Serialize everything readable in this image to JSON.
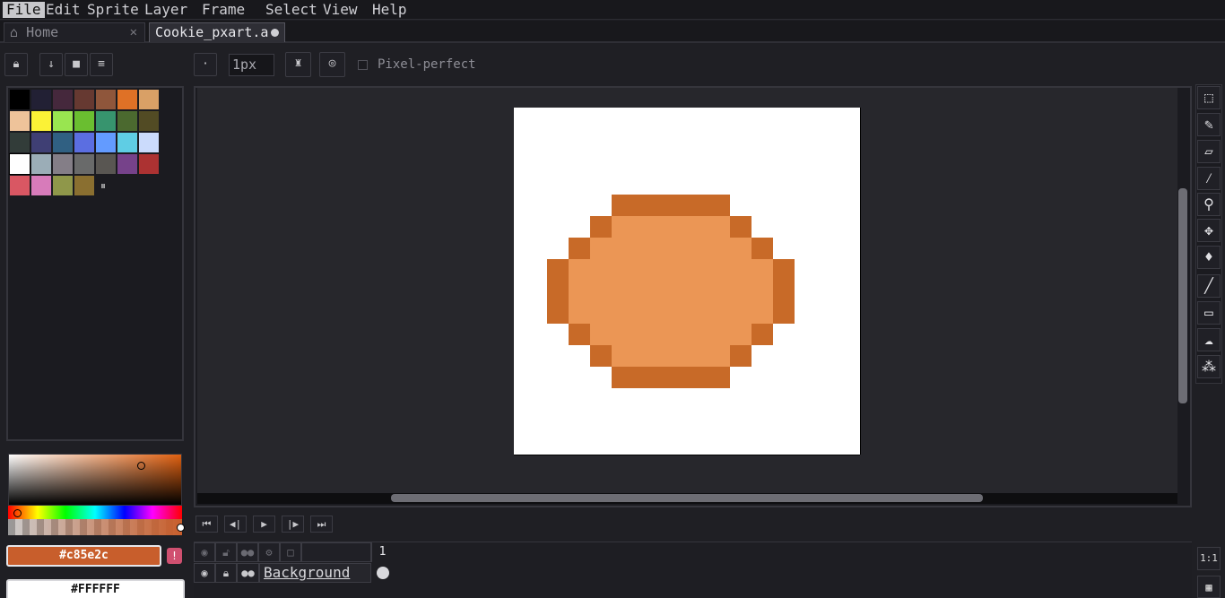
{
  "menu": [
    "File",
    "Edit",
    "Sprite",
    "Layer",
    "Frame",
    "Select",
    "View",
    "Help"
  ],
  "tabs": {
    "home": {
      "label": "Home",
      "icon": "home-icon",
      "close": "✕"
    },
    "file": {
      "label": "Cookie_pxart.a"
    }
  },
  "toolbar": {
    "brush_size": "1px",
    "pixel_perfect_label": "Pixel-perfect",
    "pixel_perfect_checked": false
  },
  "palette": {
    "colors": [
      "#000000",
      "#222034",
      "#45283c",
      "#663931",
      "#8f563b",
      "#df7126",
      "#d9a066",
      "#eec39a",
      "#fbf236",
      "#99e550",
      "#6abe30",
      "#37946e",
      "#4b692f",
      "#524b24",
      "#323c39",
      "#3f3f74",
      "#306082",
      "#5b6ee1",
      "#639bff",
      "#5fcde4",
      "#cbdbfc",
      "#ffffff",
      "#9badb7",
      "#847e87",
      "#696a6a",
      "#595652",
      "#76428a",
      "#ac3232",
      "#d95763",
      "#d77bba",
      "#8f974a",
      "#8a6f30"
    ],
    "ops_glyph": "⏸"
  },
  "color_picker": {
    "foreground_hex": "#c85e2c",
    "background_hex": "#FFFFFF",
    "warning_glyph": "!"
  },
  "sprite": {
    "colors": {
      "outline": "#c86a28",
      "fill": "#eb9655",
      "background": "#ffffff"
    }
  },
  "playback": [
    "⏮",
    "◀|",
    "▶",
    "|▶",
    "⏭"
  ],
  "timeline": {
    "frame_number": "1",
    "layer_name": "Background"
  },
  "right_tools": [
    "rectangular-marquee-icon",
    "pencil-icon",
    "eraser-icon",
    "eyedropper-icon",
    "zoom-icon",
    "move-icon",
    "paint-bucket-icon",
    "line-icon",
    "rectangle-icon",
    "contour-icon",
    "blur-icon"
  ],
  "zoom_button": "1:1"
}
